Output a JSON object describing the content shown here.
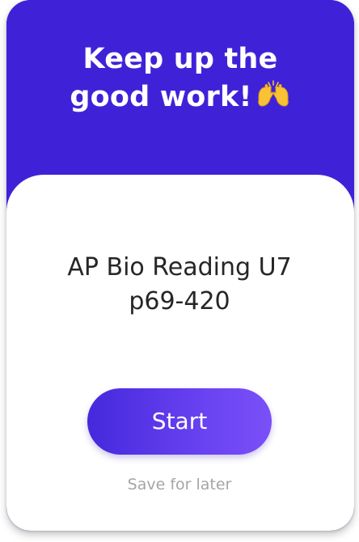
{
  "card": {
    "headline_line1": "Keep up the",
    "headline_line2": "good work!",
    "headline_icon": "raising-hands-icon",
    "task_title_line1": "AP Bio Reading U7",
    "task_title_line2": "p69-420",
    "start_label": "Start",
    "save_label": "Save for later"
  },
  "colors": {
    "header_bg": "#3f22d8",
    "panel_bg": "#ffffff",
    "title_text": "#262626",
    "button_gradient_start": "#4529dc",
    "button_gradient_end": "#7a50f7",
    "secondary_text": "#a5a5a5"
  }
}
